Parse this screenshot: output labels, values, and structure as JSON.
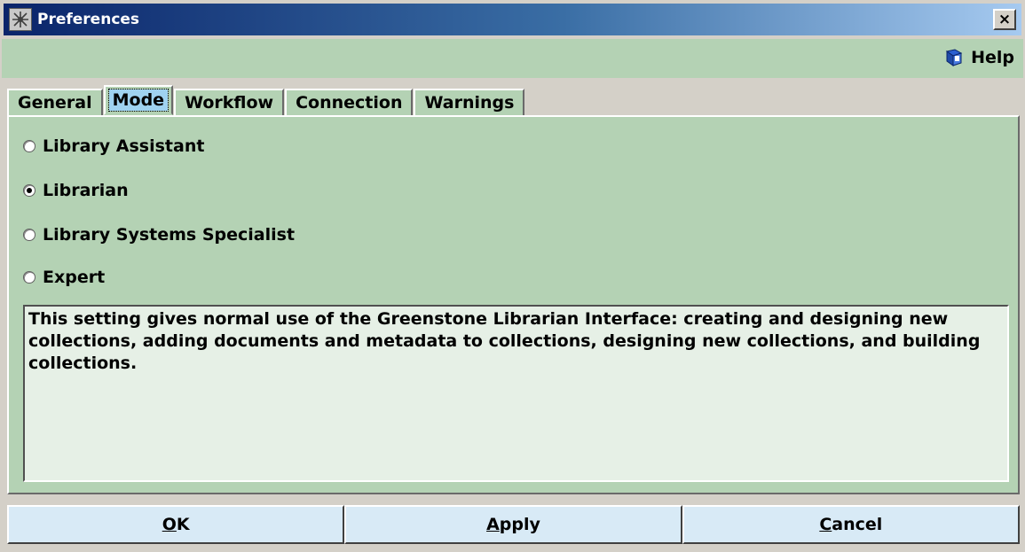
{
  "window": {
    "title": "Preferences",
    "close_glyph": "×"
  },
  "help": {
    "label": "Help",
    "icon": "help-book-icon"
  },
  "tabs": [
    {
      "label": "General",
      "selected": false
    },
    {
      "label": "Mode",
      "selected": true
    },
    {
      "label": "Workflow",
      "selected": false
    },
    {
      "label": "Connection",
      "selected": false
    },
    {
      "label": "Warnings",
      "selected": false
    }
  ],
  "modes": [
    {
      "label": "Library Assistant",
      "checked": false
    },
    {
      "label": "Librarian",
      "checked": true
    },
    {
      "label": "Library Systems Specialist",
      "checked": false
    },
    {
      "label": "Expert",
      "checked": false
    }
  ],
  "description": "This setting gives normal use of the Greenstone Librarian Interface: creating and designing new collections, adding documents and metadata to collections, designing new collections, and building collections.",
  "buttons": {
    "ok": {
      "mnemonic": "O",
      "rest": "K"
    },
    "apply": {
      "mnemonic": "A",
      "rest": "pply"
    },
    "cancel": {
      "mnemonic": "C",
      "rest": "ancel"
    }
  },
  "colors": {
    "panel": "#b4d2b4",
    "titlebar_start": "#0a246a",
    "titlebar_end": "#a6caf0",
    "button": "#d8eaf6",
    "tab_focus": "#9fd2f0"
  }
}
